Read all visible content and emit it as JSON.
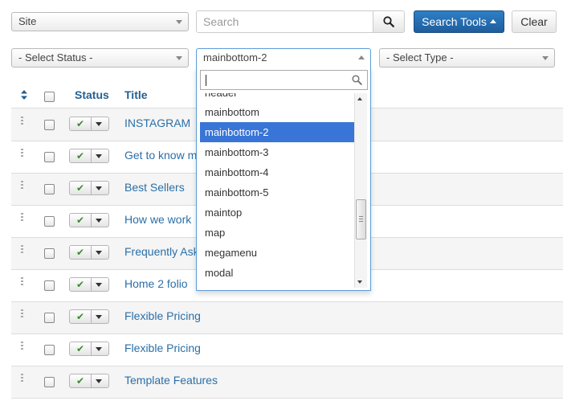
{
  "filters": {
    "site": "Site",
    "search_placeholder": "Search",
    "search_tools_label": "Search Tools",
    "clear_label": "Clear",
    "status": "- Select Status -",
    "position": "mainbottom-2",
    "type": "- Select Type -"
  },
  "table": {
    "headers": {
      "status": "Status",
      "title": "Title"
    },
    "rows": [
      "INSTAGRAM",
      "Get to know me",
      "Best Sellers",
      "How we work",
      "Frequently Asked Questions",
      "Home 2 folio",
      "Flexible Pricing",
      "Flexible Pricing",
      "Template Features"
    ]
  },
  "position_dropdown": {
    "options": [
      "header",
      "mainbottom",
      "mainbottom-2",
      "mainbottom-3",
      "mainbottom-4",
      "mainbottom-5",
      "maintop",
      "map",
      "megamenu",
      "modal"
    ],
    "selected": "mainbottom-2"
  },
  "icons": {
    "search": "search-icon",
    "sort": "sort-icon",
    "published": "check-icon",
    "drag": "drag-handle-icon"
  },
  "colors": {
    "primary": "#1f5d9b",
    "link": "#2a6fa8",
    "highlight": "#3875d7",
    "published": "#3a8a2e"
  }
}
